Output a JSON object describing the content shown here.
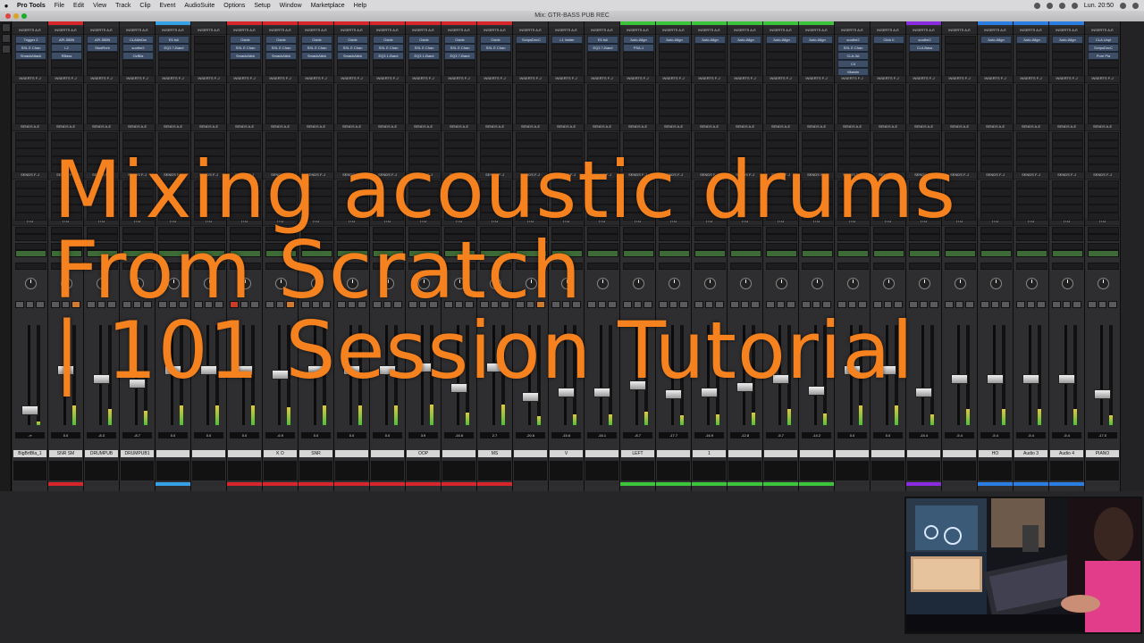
{
  "menubar": {
    "app_name": "Pro Tools",
    "items": [
      "File",
      "Edit",
      "View",
      "Track",
      "Clip",
      "Event",
      "AudioSuite",
      "Options",
      "Setup",
      "Window",
      "Marketplace",
      "Help"
    ],
    "clock": "Lun. 20:50"
  },
  "window": {
    "title": "Mix: GTR-BASS PUB REC"
  },
  "sections": {
    "inserts_ae": "INSERTS A-E",
    "inserts_fj": "INSERTS F-J",
    "sends_ae": "SENDS A-E",
    "sends_fj": "SENDS F-J",
    "io": "I / O"
  },
  "tracks": [
    {
      "name": "BigBrtBla_1",
      "color": "#2c2c2e",
      "plugins": [
        "Trigger 2",
        "SSL E Chan",
        "SmackAttack"
      ],
      "vol": "-∞",
      "fader": 0.1
    },
    {
      "name": "SNR SM",
      "color": "#d7262b",
      "plugins": [
        "API-550B",
        "L2",
        "RBass"
      ],
      "vol": "0.0",
      "fader": 0.55
    },
    {
      "name": "DRUMPUB",
      "color": "#2c2c2e",
      "plugins": [
        "API-550B",
        "StudRvrb"
      ],
      "vol": "-8.3",
      "fader": 0.45
    },
    {
      "name": "DRUMPUB1",
      "color": "#2c2c2e",
      "plugins": [
        "CLAMxDw",
        "soothe2",
        "OzBlla"
      ],
      "vol": "-8.7",
      "fader": 0.4
    },
    {
      "name": "",
      "color": "#37a1e8",
      "plugins": [
        "R1 fuli",
        "EQ3 7-Band"
      ],
      "vol": "0.0",
      "fader": 0.55
    },
    {
      "name": "",
      "color": "#2c2c2e",
      "plugins": [],
      "vol": "0.0",
      "fader": 0.55
    },
    {
      "name": "",
      "color": "#d7262b",
      "plugins": [
        "Oxide",
        "SSL E Chan",
        "SmackAttck"
      ],
      "vol": "0.0",
      "fader": 0.55
    },
    {
      "name": "K O",
      "color": "#d7262b",
      "plugins": [
        "Oxide",
        "SSL E Chan",
        "SmackAttck"
      ],
      "vol": "-6.9",
      "fader": 0.5
    },
    {
      "name": "SNR",
      "color": "#d7262b",
      "plugins": [
        "Oxide",
        "SSL E Chan",
        "SmackAttck"
      ],
      "vol": "0.0",
      "fader": 0.55
    },
    {
      "name": "",
      "color": "#d7262b",
      "plugins": [
        "Oxide",
        "SSL E Chan",
        "SmackAttck"
      ],
      "vol": "0.0",
      "fader": 0.55
    },
    {
      "name": "",
      "color": "#d7262b",
      "plugins": [
        "Oxide",
        "SSL E Chan",
        "EQ3 1-Band"
      ],
      "vol": "0.0",
      "fader": 0.55
    },
    {
      "name": "OOP",
      "color": "#d7262b",
      "plugins": [
        "Oxide",
        "SSL E Chan",
        "EQ3 1-Band"
      ],
      "vol": "3.9",
      "fader": 0.58
    },
    {
      "name": "",
      "color": "#d7262b",
      "plugins": [
        "Oxide",
        "SSL E Chan",
        "EQ3 7-Band"
      ],
      "vol": "-16.6",
      "fader": 0.35
    },
    {
      "name": "MS",
      "color": "#d7262b",
      "plugins": [
        "Oxide",
        "SSL E Chan"
      ],
      "vol": "2.7",
      "fader": 0.58
    },
    {
      "name": "",
      "color": "#2c2c2e",
      "plugins": [
        "SchpsDncC"
      ],
      "vol": "-20.6",
      "fader": 0.25
    },
    {
      "name": "V",
      "color": "#2c2c2e",
      "plugins": [
        "L1 limiter"
      ],
      "vol": "-15.6",
      "fader": 0.3
    },
    {
      "name": "",
      "color": "#2c2c2e",
      "plugins": [
        "R1 fuli",
        "EQ3 7-Band"
      ],
      "vol": "-16.1",
      "fader": 0.3
    },
    {
      "name": "LEFT",
      "color": "#3cc43a",
      "plugins": [
        "Auto-Align",
        "PSA-1"
      ],
      "vol": "-8.7",
      "fader": 0.38
    },
    {
      "name": "",
      "color": "#3cc43a",
      "plugins": [
        "Auto-Align"
      ],
      "vol": "-17.7",
      "fader": 0.28
    },
    {
      "name": "1",
      "color": "#3cc43a",
      "plugins": [
        "Auto-Align"
      ],
      "vol": "-16.9",
      "fader": 0.3
    },
    {
      "name": "",
      "color": "#3cc43a",
      "plugins": [
        "Auto-Align"
      ],
      "vol": "-12.8",
      "fader": 0.36
    },
    {
      "name": "",
      "color": "#3cc43a",
      "plugins": [
        "Auto-Align"
      ],
      "vol": "-5.7",
      "fader": 0.45
    },
    {
      "name": "",
      "color": "#3cc43a",
      "plugins": [
        "Auto-Align"
      ],
      "vol": "-14.2",
      "fader": 0.32
    },
    {
      "name": "",
      "color": "#2c2c2e",
      "plugins": [
        "soothe2",
        "SSL E Chan",
        "CLA-3A",
        "C4",
        "Vitamin"
      ],
      "vol": "0.0",
      "fader": 0.55
    },
    {
      "name": "",
      "color": "#2c2c2e",
      "plugins": [
        "Click II"
      ],
      "vol": "0.0",
      "fader": 0.55
    },
    {
      "name": "",
      "color": "#8a2be2",
      "plugins": [
        "soothe2",
        "CLA Bass"
      ],
      "vol": "-15.4",
      "fader": 0.3
    },
    {
      "name": "",
      "color": "#2c2c2e",
      "plugins": [],
      "vol": "-5.4",
      "fader": 0.45
    },
    {
      "name": "HO",
      "color": "#2a7de1",
      "plugins": [
        "Auto-Align"
      ],
      "vol": "-5.4",
      "fader": 0.45
    },
    {
      "name": "Audio 3",
      "color": "#2a7de1",
      "plugins": [
        "Auto-Align"
      ],
      "vol": "-5.4",
      "fader": 0.45
    },
    {
      "name": "Audio 4",
      "color": "#2a7de1",
      "plugins": [
        "Auto-Align"
      ],
      "vol": "-5.4",
      "fader": 0.45
    },
    {
      "name": "PIANO",
      "color": "#2c2c2e",
      "plugins": [
        "CLA Unpl",
        "SchpsDncC",
        "Pure Pla"
      ],
      "vol": "-17.0",
      "fader": 0.28
    }
  ],
  "overlay": {
    "line1": "Mixing acoustic drums",
    "line2": "From Scratch",
    "line3": "| 101 Session Tutorial"
  }
}
